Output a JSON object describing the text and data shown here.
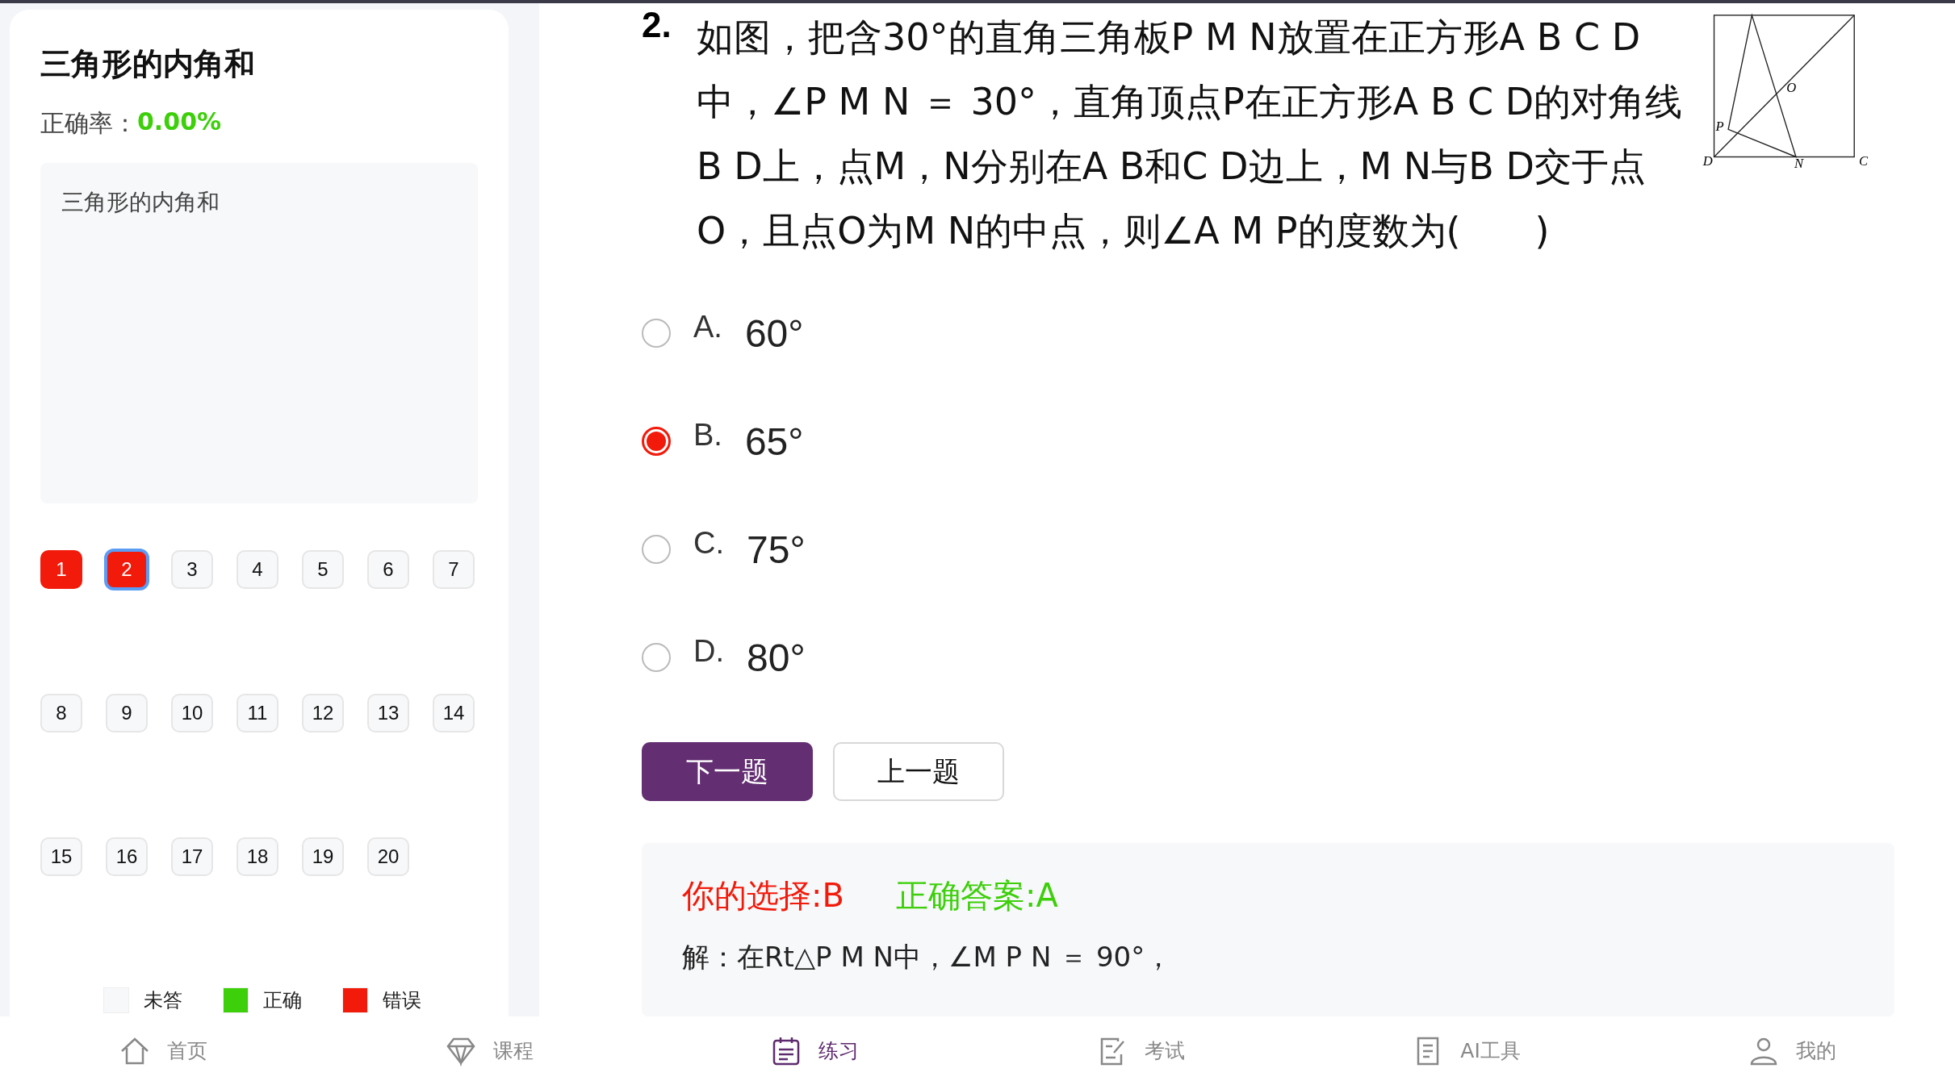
{
  "sidebar": {
    "title": "三角形的内角和",
    "accuracy_label": "正确率：",
    "accuracy_value": "0.00%",
    "description": "三角形的内角和",
    "questions": [
      {
        "label": "1",
        "kind": "wrong",
        "current": false
      },
      {
        "label": "2",
        "kind": "wrong",
        "current": true
      },
      {
        "label": "3",
        "kind": "unanswered",
        "current": false
      },
      {
        "label": "4",
        "kind": "unanswered",
        "current": false
      },
      {
        "label": "5",
        "kind": "unanswered",
        "current": false
      },
      {
        "label": "6",
        "kind": "unanswered",
        "current": false
      },
      {
        "label": "7",
        "kind": "unanswered",
        "current": false
      },
      {
        "label": "8",
        "kind": "unanswered",
        "current": false
      },
      {
        "label": "9",
        "kind": "unanswered",
        "current": false
      },
      {
        "label": "10",
        "kind": "unanswered",
        "current": false
      },
      {
        "label": "11",
        "kind": "unanswered",
        "current": false
      },
      {
        "label": "12",
        "kind": "unanswered",
        "current": false
      },
      {
        "label": "13",
        "kind": "unanswered",
        "current": false
      },
      {
        "label": "14",
        "kind": "unanswered",
        "current": false
      },
      {
        "label": "15",
        "kind": "unanswered",
        "current": false
      },
      {
        "label": "16",
        "kind": "unanswered",
        "current": false
      },
      {
        "label": "17",
        "kind": "unanswered",
        "current": false
      },
      {
        "label": "18",
        "kind": "unanswered",
        "current": false
      },
      {
        "label": "19",
        "kind": "unanswered",
        "current": false
      },
      {
        "label": "20",
        "kind": "unanswered",
        "current": false
      }
    ],
    "legend": [
      {
        "label": "未答",
        "color": "#f7f8fa"
      },
      {
        "label": "正确",
        "color": "#3ccf0a"
      },
      {
        "label": "错误",
        "color": "#f21a0a"
      }
    ]
  },
  "question": {
    "number": "2.",
    "text": "如图，把含30°的直角三角板P M N放置在正方形A B C D中，∠P M N ＝ 30°，直角顶点P在正方形A B C D的对角线B D上，点M，N分别在A B和C D边上，M N与B D交于点O，且点O为M N的中点，则∠A M P的度数为(　　)",
    "diagram_labels": [
      "P",
      "O",
      "D",
      "N",
      "C"
    ],
    "options": [
      {
        "letter": "A.",
        "value": "60°",
        "selected": false
      },
      {
        "letter": "B.",
        "value": "65°",
        "selected": true
      },
      {
        "letter": "C.",
        "value": "75°",
        "selected": false
      },
      {
        "letter": "D.",
        "value": "80°",
        "selected": false
      }
    ]
  },
  "buttons": [
    "下一题",
    "上一题"
  ],
  "feedback": {
    "your_choice": "你的选择:B",
    "correct_answer": "正确答案:A",
    "solution": "解：在Rt△P M N中，∠M P N ＝ 90°，"
  },
  "nav": [
    {
      "label": "首页",
      "selected": false
    },
    {
      "label": "课程",
      "selected": false
    },
    {
      "label": "练习",
      "selected": true
    },
    {
      "label": "考试",
      "selected": false
    },
    {
      "label": "AI工具",
      "selected": false
    },
    {
      "label": "我的",
      "selected": false
    }
  ]
}
